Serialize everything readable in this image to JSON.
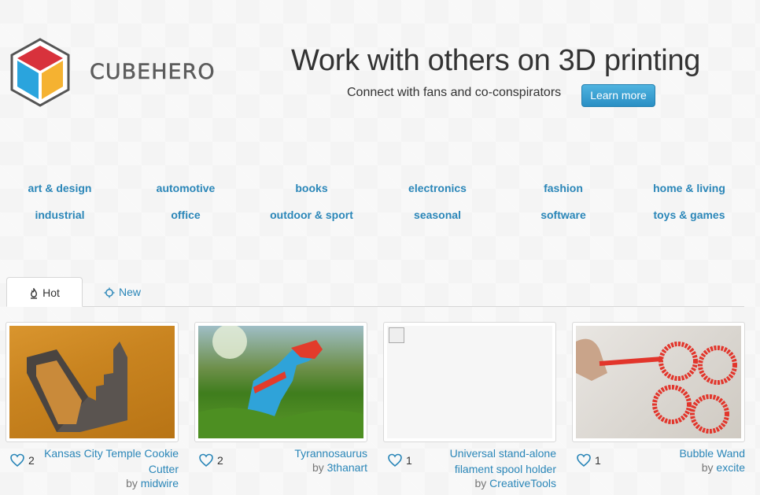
{
  "brand": {
    "name": "CUBEHERO"
  },
  "hero": {
    "headline": "Work with others on 3D printing",
    "subline": "Connect with fans and co-conspirators",
    "cta_label": "Learn more"
  },
  "categories": {
    "row1": [
      "art & design",
      "automotive",
      "books",
      "electronics",
      "fashion",
      "home & living"
    ],
    "row2": [
      "industrial",
      "office",
      "outdoor & sport",
      "seasonal",
      "software",
      "toys & games"
    ]
  },
  "tabs": [
    {
      "label": "Hot",
      "icon": "flame-icon",
      "active": true
    },
    {
      "label": "New",
      "icon": "sun-icon",
      "active": false
    }
  ],
  "cards": [
    {
      "likes": "2",
      "title_lines": [
        "Kansas City Temple Cookie",
        "Cutter"
      ],
      "by": "by",
      "author": "midwire",
      "image": "wood-cutter"
    },
    {
      "likes": "2",
      "title_lines": [
        "Tyrannosaurus"
      ],
      "by": "by",
      "author": "3thanart",
      "image": "grass-dinosaur"
    },
    {
      "likes": "1",
      "title_lines": [
        "Universal stand-alone",
        "filament spool holder"
      ],
      "by": "by",
      "author": "CreativeTools",
      "image": "broken"
    },
    {
      "likes": "1",
      "title_lines": [
        "Bubble Wand"
      ],
      "by": "by",
      "author": "excite",
      "image": "bubble-wand"
    }
  ],
  "colors": {
    "link": "#2a86b8",
    "cta": "#3aa3d6",
    "cube_red": "#d8323c",
    "cube_blue": "#2aa4dd",
    "cube_yellow": "#f5b231"
  }
}
